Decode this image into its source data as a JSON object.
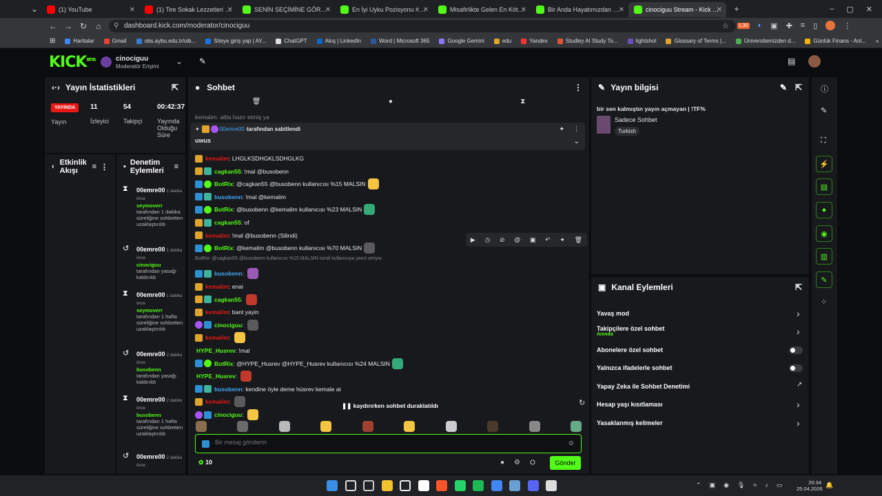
{
  "browser": {
    "tabs": [
      {
        "title": "(1) YouTube",
        "color": "#ff0000"
      },
      {
        "title": "(1) Tire Sokak Lezzetleri | Vlog",
        "color": "#ff0000"
      },
      {
        "title": "SENİN SEÇİMİNE GÖRE EN İYİ",
        "color": "#53fc18"
      },
      {
        "title": "En İyi Uyku Pozisyonu #1 - Tier",
        "color": "#53fc18"
      },
      {
        "title": "Misafirlikte Gelen En Kötü İkram",
        "color": "#53fc18"
      },
      {
        "title": "Bir Anda Hayatımızdan Çıkan A",
        "color": "#53fc18"
      },
      {
        "title": "cinociguu Stream - Kick Dashb",
        "color": "#53fc18"
      }
    ],
    "url": "dashboard.kick.com/moderator/cinociguu",
    "bookmarks": [
      "Haritalar",
      "Gmail",
      "obs.aybu.edu.tr/oib...",
      "Siteye giriş yap | AY...",
      "ChatGPT",
      "Akış | LinkedIn",
      "Word | Microsoft 365",
      "Google Gemini",
      "edu",
      "Yandex",
      "Studley AI Study To...",
      "lightshot",
      "Glossary of Terms |...",
      "Üniversitemizden d...",
      "Günlük Finans - Anl..."
    ],
    "badge_count": "1.30"
  },
  "header": {
    "logo": "KICK",
    "logo_sup": "BETA",
    "channel": "cinociguu",
    "role": "Moderatör Erişimi"
  },
  "stats": {
    "title": "Yayın İstatistikleri",
    "live_badge": "YAYINDA",
    "live_label": "Yayın",
    "viewers": "11",
    "viewers_label": "İzleyici",
    "followers": "54",
    "followers_label": "Takipçi",
    "duration": "00:42:37",
    "duration_label": "Yayında Olduğu Süre"
  },
  "activity": {
    "title": "Etkinlik Akışı"
  },
  "modlog": {
    "title": "Denetim Eylemleri",
    "items": [
      {
        "user": "00emre00",
        "time": "1 dakika önce",
        "target": "seymoverr",
        "text": "tarafından 1 dakika süreliğine sohbetten uzaklaştırıldı"
      },
      {
        "user": "00emre00",
        "time": "1 dakika önce",
        "target": "cinociguu",
        "text": "tarafından yasağı kaldırıldı"
      },
      {
        "user": "00emre00",
        "time": "1 dakika önce",
        "target": "seymoverr",
        "text": "tarafından 1 hafta süreliğine sohbetten uzaklaştırıldı"
      },
      {
        "user": "00emre00",
        "time": "2 dakika önce",
        "target": "busobenn",
        "text": "tarafından yasağı kaldırıldı"
      },
      {
        "user": "00emre00",
        "time": "2 dakika önce",
        "target": "busobenn",
        "text": "tarafından 1 hafta süreliğine sohbetten uzaklaştırıldı"
      },
      {
        "user": "00emre00",
        "time": "2 dakika önce",
        "target": "",
        "text": ""
      }
    ]
  },
  "chat": {
    "title": "Sohbet",
    "pinned_by": "00emre00",
    "pinned_suffix": "tarafından sabitlendi",
    "pinned_text": "uwus",
    "partial_top": "kemalim: altta hazır etmiş ya",
    "messages": [
      {
        "badges": [
          "crown"
        ],
        "user": "kemalim",
        "ucolor": "#e91916",
        "text": "LHGLKSDHGKLSDHGLKG"
      },
      {
        "badges": [
          "crown",
          "sub"
        ],
        "user": "cagkan55",
        "ucolor": "#53fc18",
        "text": "!mal @busobenn"
      },
      {
        "badges": [
          "mod",
          "ver"
        ],
        "user": "BotRix",
        "ucolor": "#53fc18",
        "text": "@cagkan55 @busobenn kullanıcısı %15 MALSIN",
        "emote": true
      },
      {
        "badges": [
          "mod",
          "sub"
        ],
        "user": "busobenn",
        "ucolor": "#3fa9f5",
        "text": "!mal @kemalim"
      },
      {
        "badges": [
          "mod",
          "ver"
        ],
        "user": "BotRix",
        "ucolor": "#53fc18",
        "text": "@busobenn @kemalim kullanıcısı %23 MALSIN",
        "emote": true
      },
      {
        "badges": [
          "crown",
          "sub"
        ],
        "user": "cagkan55",
        "ucolor": "#53fc18",
        "text": "of"
      },
      {
        "badges": [
          "crown"
        ],
        "user": "kemalim",
        "ucolor": "#e91916",
        "text": "!mal @busobenn (Silindi)"
      },
      {
        "badges": [
          "mod",
          "ver"
        ],
        "user": "BotRix",
        "ucolor": "#53fc18",
        "text": "@kemalim @busobenn kullanıcısı %70 MALSIN",
        "emote": true
      },
      {
        "badges": [],
        "user": "",
        "ucolor": "#999",
        "text": "BotRix: @cagkan55 @busobenn kullanıcısı %15 MALSIN   isimli kullanıcıya yanıt veriyor",
        "reply": true
      },
      {
        "badges": [
          "mod",
          "sub"
        ],
        "user": "busobenn",
        "ucolor": "#3fa9f5",
        "text": "",
        "emote": true
      },
      {
        "badges": [
          "crown"
        ],
        "user": "kemalim",
        "ucolor": "#e91916",
        "text": "enai"
      },
      {
        "badges": [
          "crown",
          "sub"
        ],
        "user": "cagkan55",
        "ucolor": "#53fc18",
        "text": "",
        "emote": true
      },
      {
        "badges": [
          "crown"
        ],
        "user": "kemalim",
        "ucolor": "#e91916",
        "text": "bant yayin"
      },
      {
        "badges": [
          "mic",
          "mod"
        ],
        "user": "cinociguu",
        "ucolor": "#53fc18",
        "text": "",
        "emote": true
      },
      {
        "badges": [
          "crown"
        ],
        "user": "kemalim",
        "ucolor": "#e91916",
        "text": "",
        "emote": true
      },
      {
        "badges": [],
        "user": "HYPE_Husrev",
        "ucolor": "#53fc18",
        "text": "!mal"
      },
      {
        "badges": [
          "mod",
          "ver"
        ],
        "user": "BotRix",
        "ucolor": "#53fc18",
        "text": "@HYPE_Husrev @HYPE_Husrev kullanıcısı %24 MALSIN",
        "emote": true
      },
      {
        "badges": [],
        "user": "HYPE_Husrev",
        "ucolor": "#53fc18",
        "text": "",
        "emote": true
      },
      {
        "badges": [
          "mod",
          "sub"
        ],
        "user": "busobenn",
        "ucolor": "#3fa9f5",
        "text": "kendine öyle deme hüsrev kemale at"
      },
      {
        "badges": [
          "crown"
        ],
        "user": "kemalim",
        "ucolor": "#e91916",
        "text": "",
        "emote": true
      },
      {
        "badges": [
          "mic",
          "mod"
        ],
        "user": "cinociguu",
        "ucolor": "#53fc18",
        "text": "",
        "emote": true
      }
    ],
    "paused": "kaydırırken sohbet duraklatıldı",
    "input_placeholder": "Bir mesaj gönderin",
    "points": "10",
    "send": "Gönder"
  },
  "stream_info": {
    "title": "Yayın bilgisi",
    "stream_title": "bir sen kalmıştın yayın açmayan | !TF%",
    "category": "Sadece Sohbet",
    "language": "Turkish"
  },
  "channel_actions": {
    "title": "Kanal Eylemleri",
    "slow": "Yavaş mod",
    "followers_only": "Takipçilere özel sohbet",
    "followers_only_sub": "Anında",
    "subs_only": "Abonelere özel sohbet",
    "emotes_only": "Yalnızca ifadelerle sohbet",
    "ai_mod": "Yapay Zeka ile Sohbet Denetimi",
    "account_age": "Hesap yaşı kısıtlaması",
    "banned_words": "Yasaklanmış kelimeler"
  },
  "taskbar": {
    "time": "20:34",
    "date": "25.04.2026"
  }
}
